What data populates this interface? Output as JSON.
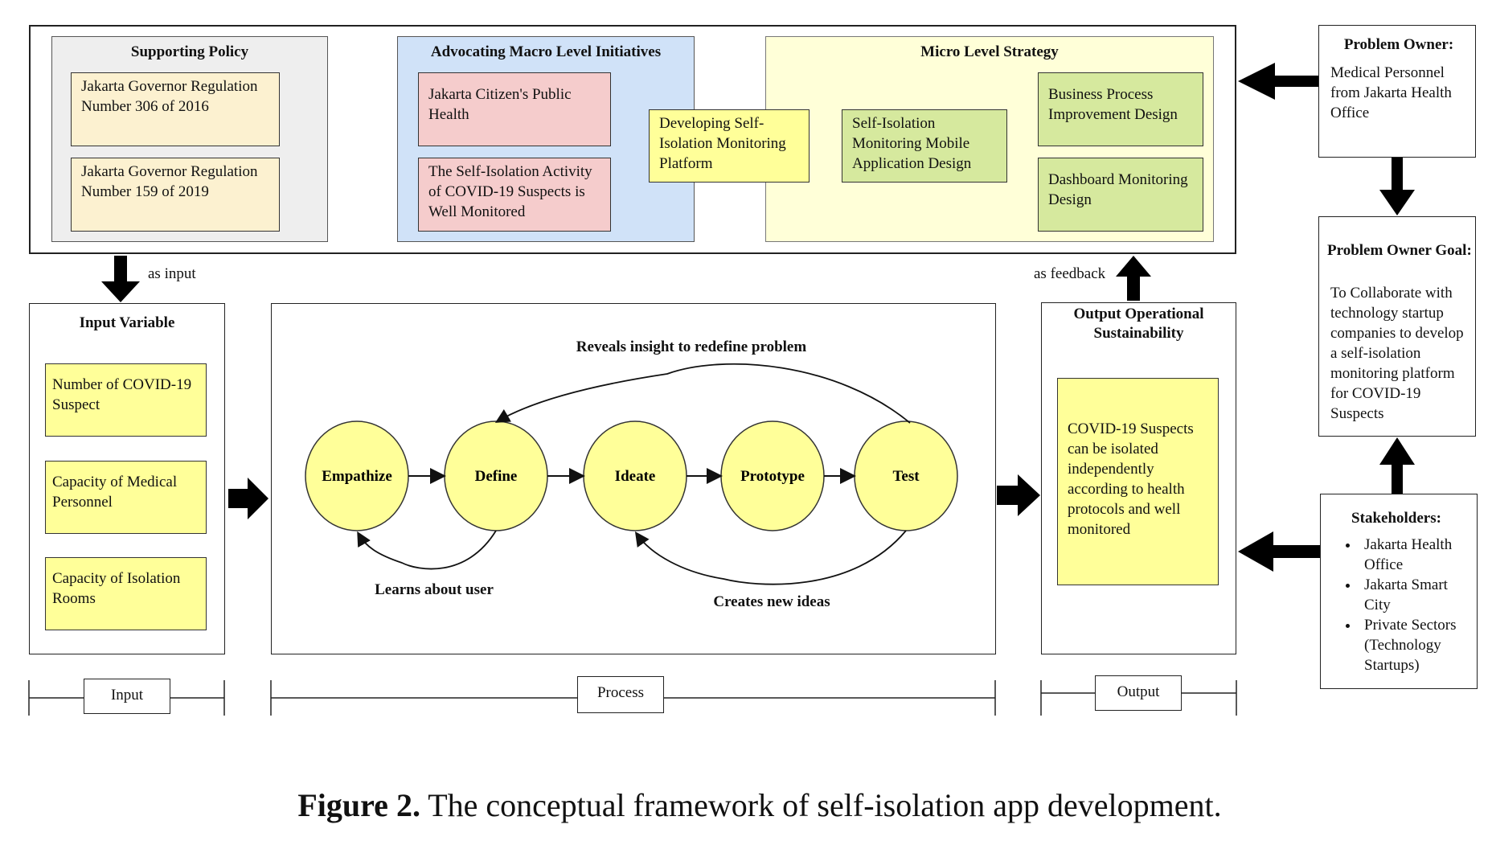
{
  "top_section": {
    "supporting_policy": {
      "title": "Supporting Policy",
      "items": [
        "Jakarta Governor Regulation Number 306 of 2016",
        "Jakarta Governor Regulation Number 159 of 2019"
      ]
    },
    "macro": {
      "title": "Advocating Macro Level Initiatives",
      "items": [
        "Jakarta Citizen's Public Health",
        "The Self-Isolation Activity of COVID-19 Suspects is Well Monitored"
      ]
    },
    "bridge": "Developing Self-Isolation Monitoring Platform",
    "micro": {
      "title": "Micro Level Strategy",
      "app_design": "Self-Isolation Monitoring Mobile Application Design",
      "bpi_design": "Business Process Improvement Design",
      "dashboard_design": "Dashboard Monitoring Design"
    }
  },
  "problem_owner": {
    "title": "Problem Owner:",
    "text": "Medical Personnel from Jakarta Health Office"
  },
  "problem_owner_goal": {
    "title": "Problem Owner Goal:",
    "text": "To Collaborate with technology startup companies to develop a self-isolation monitoring platform for COVID-19 Suspects"
  },
  "stakeholders": {
    "title": "Stakeholders:",
    "items": [
      "Jakarta Health Office",
      "Jakarta Smart City",
      "Private Sectors (Technology Startups)"
    ]
  },
  "flow_labels": {
    "as_input": "as input",
    "as_feedback": "as feedback"
  },
  "input_variable": {
    "title": "Input Variable",
    "items": [
      "Number of COVID-19 Suspect",
      "Capacity of Medical Personnel",
      "Capacity of Isolation Rooms"
    ]
  },
  "process": {
    "stages": [
      "Empathize",
      "Define",
      "Ideate",
      "Prototype",
      "Test"
    ],
    "loop_top": "Reveals insight to redefine problem",
    "loop_left": "Learns about user",
    "loop_right": "Creates new ideas"
  },
  "output": {
    "title": "Output Operational Sustainability",
    "text": "COVID-19 Suspects can be isolated independently according to health protocols and well monitored"
  },
  "brackets": {
    "input": "Input",
    "process": "Process",
    "output": "Output"
  },
  "caption": {
    "label": "Figure 2.",
    "text": " The conceptual framework of self-isolation app development."
  },
  "colors": {
    "stage_fill": "#FFFF99",
    "policy_item": "#FCF1D0",
    "macro_bg": "#D0E2F8",
    "macro_item": "#F5CCCC",
    "micro_bg": "#FFFFD8",
    "micro_item": "#D6E99E"
  }
}
